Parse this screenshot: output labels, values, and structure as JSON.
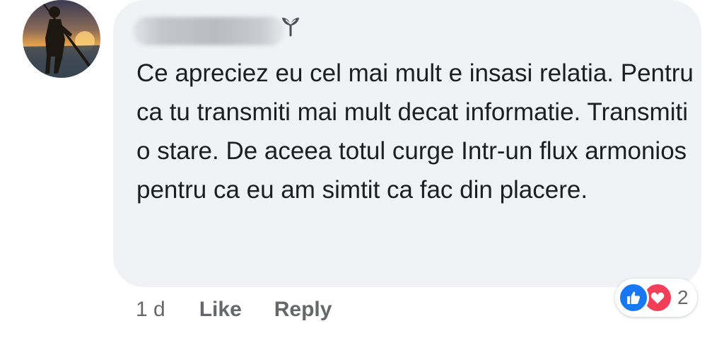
{
  "comment": {
    "author": {
      "name": ""
    },
    "text": "Ce apreciez eu cel mai mult e insasi relatia. Pentru ca tu transmiti mai mult decat informatie. Transmiti o stare. De aceea totul curge Intr-un flux armonios pentru ca eu am simtit ca fac din placere.",
    "meta": {
      "time": "1 d",
      "like_label": "Like",
      "reply_label": "Reply"
    },
    "reactions": {
      "types": [
        "like",
        "love"
      ],
      "count": "2"
    }
  },
  "icons": {
    "badge": "sprout-icon",
    "like": "thumbs-up-icon",
    "love": "heart-icon"
  },
  "colors": {
    "bubble": "#f0f2f5",
    "text": "#1c1e21",
    "meta": "#65676b",
    "like": "#1877f2",
    "love": "#f33e58"
  }
}
